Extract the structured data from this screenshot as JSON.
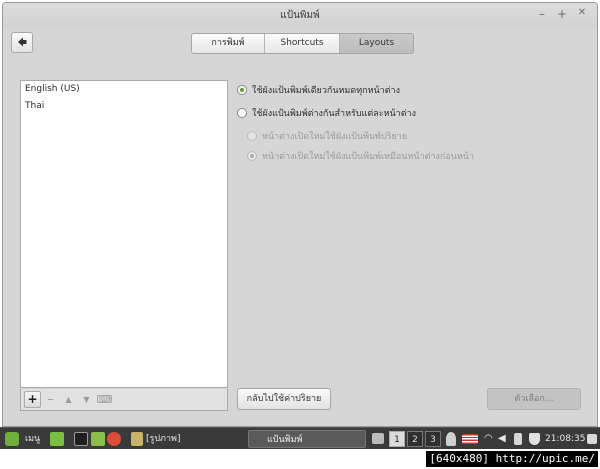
{
  "window": {
    "title": "แป้นพิมพ์",
    "controls": {
      "minimize": "–",
      "maximize": "+",
      "close": "✕"
    }
  },
  "toolbar": {
    "back_icon": "left-arrow-icon",
    "tabs": [
      {
        "label": "การพิมพ์",
        "active": false
      },
      {
        "label": "Shortcuts",
        "active": false
      },
      {
        "label": "Layouts",
        "active": true
      }
    ]
  },
  "layouts": {
    "items": [
      "English (US)",
      "Thai"
    ],
    "tools": [
      "+",
      "–",
      "▲",
      "▼",
      "⌨"
    ]
  },
  "options": {
    "same_layout": "ใช้ผังแป้นพิมพ์เดียวกันหมดทุกหน้าต่าง",
    "per_window": "ใช้ผังแป้นพิมพ์ต่างกันสำหรับแต่ละหน้าต่าง",
    "new_default": "หน้าต่างเปิดใหม่ใช้ผังแป้นพิมพ์ปริยาย",
    "new_previous": "หน้าต่างเปิดใหม่ใช้ผังแป้นพิมพ์เหมือนหน้าต่างก่อนหน้า"
  },
  "buttons": {
    "reset": "กลับไปใช้ค่าปริยาย",
    "options": "ตัวเลือก..."
  },
  "panel": {
    "menu_label": "เมนู",
    "folder_label": "[รูปภาพ]",
    "task_label": "แป้นพิมพ์",
    "workspaces": [
      "1",
      "2",
      "3"
    ],
    "clock": "21:08:35"
  },
  "caption": "[640x480] http://upic.me/",
  "colors": {
    "accent": "#5f9a3a",
    "panel": "#3a3a3a",
    "window": "#d6d6d6"
  }
}
